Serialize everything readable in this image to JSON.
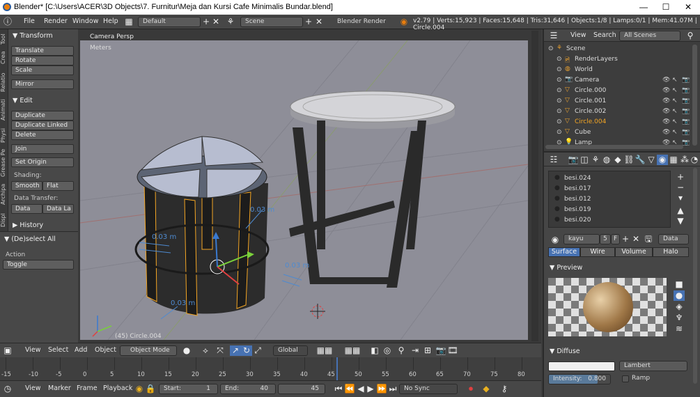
{
  "window": {
    "title": "Blender* [C:\\Users\\ACER\\3D Objects\\7. Furnitur\\Meja dan Kursi Cafe Minimalis Bundar.blend]",
    "minimize": "—",
    "maximize": "☐",
    "close": "✕"
  },
  "info_header": {
    "menus": [
      "File",
      "Render",
      "Window",
      "Help"
    ],
    "screen_layout": "Default",
    "scene": "Scene",
    "render_engine": "Blender Render",
    "stats": "v2.79 | Verts:15,923 | Faces:15,648 | Tris:31,646 | Objects:1/8 | Lamps:0/1 | Mem:41.07M | Circle.004"
  },
  "tool_tabs": [
    "Tool",
    "Crea",
    "Relatio",
    "Animati",
    "Physi",
    "Grease Pe",
    "Archipa",
    "Displ"
  ],
  "toolshelf": {
    "transform_header": "Transform",
    "transform_buttons": [
      "Translate",
      "Rotate",
      "Scale"
    ],
    "mirror": "Mirror",
    "edit_header": "Edit",
    "edit_buttons": [
      "Duplicate",
      "Duplicate Linked",
      "Delete"
    ],
    "join": "Join",
    "set_origin": "Set Origin",
    "shading_label": "Shading:",
    "smooth": "Smooth",
    "flat": "Flat",
    "data_transfer_label": "Data Transfer:",
    "data": "Data",
    "data_layers": "Data La",
    "history_header": "History"
  },
  "operator": {
    "header": "(De)select All",
    "action_label": "Action",
    "action_value": "Toggle"
  },
  "viewport": {
    "view_name": "Camera Persp",
    "units": "Meters",
    "object_info": "(45) Circle.004",
    "dimensions": [
      "0.03 m",
      "0.03 m",
      "0.03 m",
      "0.03 m"
    ]
  },
  "view3d_header": {
    "menus": [
      "View",
      "Select",
      "Add",
      "Object"
    ],
    "mode": "Object Mode",
    "orientation": "Global"
  },
  "timeline": {
    "ticks": [
      "-15",
      "-10",
      "-5",
      "0",
      "5",
      "10",
      "15",
      "20",
      "25",
      "30",
      "35",
      "40",
      "45",
      "50",
      "55",
      "60",
      "65",
      "70",
      "75",
      "80"
    ],
    "current_frame_marker": 45,
    "menus": [
      "View",
      "Marker",
      "Frame",
      "Playback"
    ],
    "start_label": "Start:",
    "start_value": "1",
    "end_label": "End:",
    "end_value": "40",
    "current_frame": "45",
    "sync": "No Sync"
  },
  "outliner": {
    "menus": [
      "View",
      "Search"
    ],
    "scenes_select": "All Scenes",
    "rows": [
      {
        "label": "Scene",
        "indent": 0
      },
      {
        "label": "RenderLayers",
        "indent": 1
      },
      {
        "label": "World",
        "indent": 1
      },
      {
        "label": "Camera",
        "indent": 1
      },
      {
        "label": "Circle.000",
        "indent": 1
      },
      {
        "label": "Circle.001",
        "indent": 1
      },
      {
        "label": "Circle.002",
        "indent": 1
      },
      {
        "label": "Circle.004",
        "indent": 1,
        "selected": true
      },
      {
        "label": "Cube",
        "indent": 1
      },
      {
        "label": "Lamp",
        "indent": 1
      }
    ]
  },
  "properties": {
    "materials": [
      "besi.024",
      "besi.017",
      "besi.012",
      "besi.019",
      "besi.020"
    ],
    "material_name": "kayu",
    "users": "5",
    "fake_user": "F",
    "link": "Data",
    "subtabs": [
      "Surface",
      "Wire",
      "Volume",
      "Halo"
    ],
    "preview_header": "Preview",
    "diffuse_header": "Diffuse",
    "diffuse_shader": "Lambert",
    "intensity_label": "Intensity:",
    "intensity_value": "0.800",
    "ramp_label": "Ramp",
    "accent": "#4772b3",
    "selected_color": "#f5a623"
  }
}
